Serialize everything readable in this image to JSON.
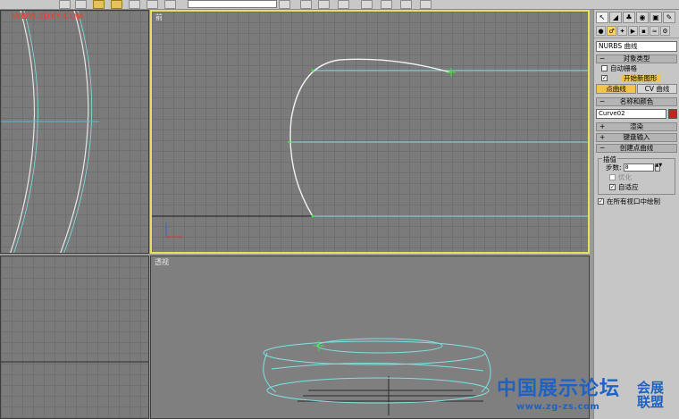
{
  "watermark_top": "WWW.3DXY.COM",
  "watermark_bottom": {
    "main": "中国展示论坛",
    "url": "www.zg-zs.com",
    "side_line1": "会展",
    "side_line2": "联盟"
  },
  "viewports": {
    "front_label": "前",
    "perspective_label": "透视"
  },
  "panel": {
    "object_type_dropdown": "NURBS 曲线",
    "object_type": {
      "header": "对象类型",
      "auto_grid_label": "自动栅格",
      "start_new_shape_label": "开始新图形",
      "point_curve_button": "点曲线",
      "cv_curve_button": "CV 曲线"
    },
    "name_color": {
      "header": "名称和颜色",
      "name_value": "Curve02",
      "swatch_color": "#c0281e"
    },
    "rendering_header": "渲染",
    "keyboard_entry_header": "键盘输入",
    "create_point_curve": {
      "header": "创建点曲线",
      "interpolation_group": "插值",
      "steps_label": "步数:",
      "steps_value": "8",
      "optimize_label": "优化",
      "adaptive_label": "自适应",
      "draw_all_viewports_label": "在所有视口中绘制"
    }
  },
  "accent_colors": {
    "active_viewport_border": "#e8e066",
    "curve_white": "#f2f2f2",
    "cyan_guides": "#7fe0e0",
    "selected_button": "#f2c44a"
  }
}
